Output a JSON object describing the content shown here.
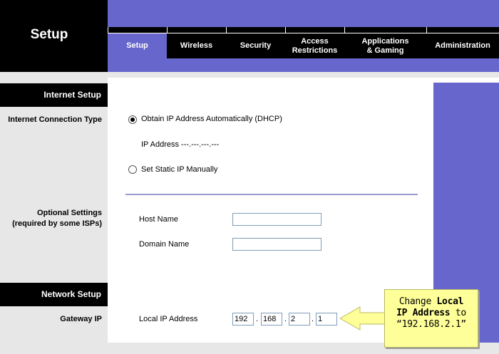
{
  "header": {
    "section_title": "Setup",
    "tabs": [
      {
        "label": "Setup",
        "active": true
      },
      {
        "label": "Wireless",
        "active": false
      },
      {
        "label": "Security",
        "active": false
      },
      {
        "label": "Access\nRestrictions",
        "active": false
      },
      {
        "label": "Applications\n& Gaming",
        "active": false
      },
      {
        "label": "Administration",
        "active": false
      }
    ]
  },
  "sidebar": {
    "internet_setup": "Internet Setup",
    "connection_type": "Internet Connection Type",
    "optional_settings_1": "Optional Settings",
    "optional_settings_2": "(required by some ISPs)",
    "network_setup": "Network Setup",
    "gateway_ip": "Gateway IP"
  },
  "main": {
    "dhcp_option": "Obtain IP Address Automatically (DHCP)",
    "ip_address_line": "IP Address ---.---.---.---",
    "static_option": "Set Static IP Manually",
    "host_name_label": "Host Name",
    "host_name_value": "",
    "domain_name_label": "Domain Name",
    "domain_name_value": "",
    "local_ip_label": "Local IP Address",
    "local_ip": [
      "192",
      "168",
      "2",
      "1"
    ]
  },
  "callout": {
    "line1_plain": "Change ",
    "line1_bold": "Local",
    "line2_bold": "IP Address",
    "line2_plain": " to",
    "line3": "“192.168.2.1”"
  },
  "colors": {
    "accent": "#6666cc",
    "header_bg": "#000000",
    "sidebar_bg": "#e7e7e7",
    "callout_bg": "#ffff99"
  }
}
